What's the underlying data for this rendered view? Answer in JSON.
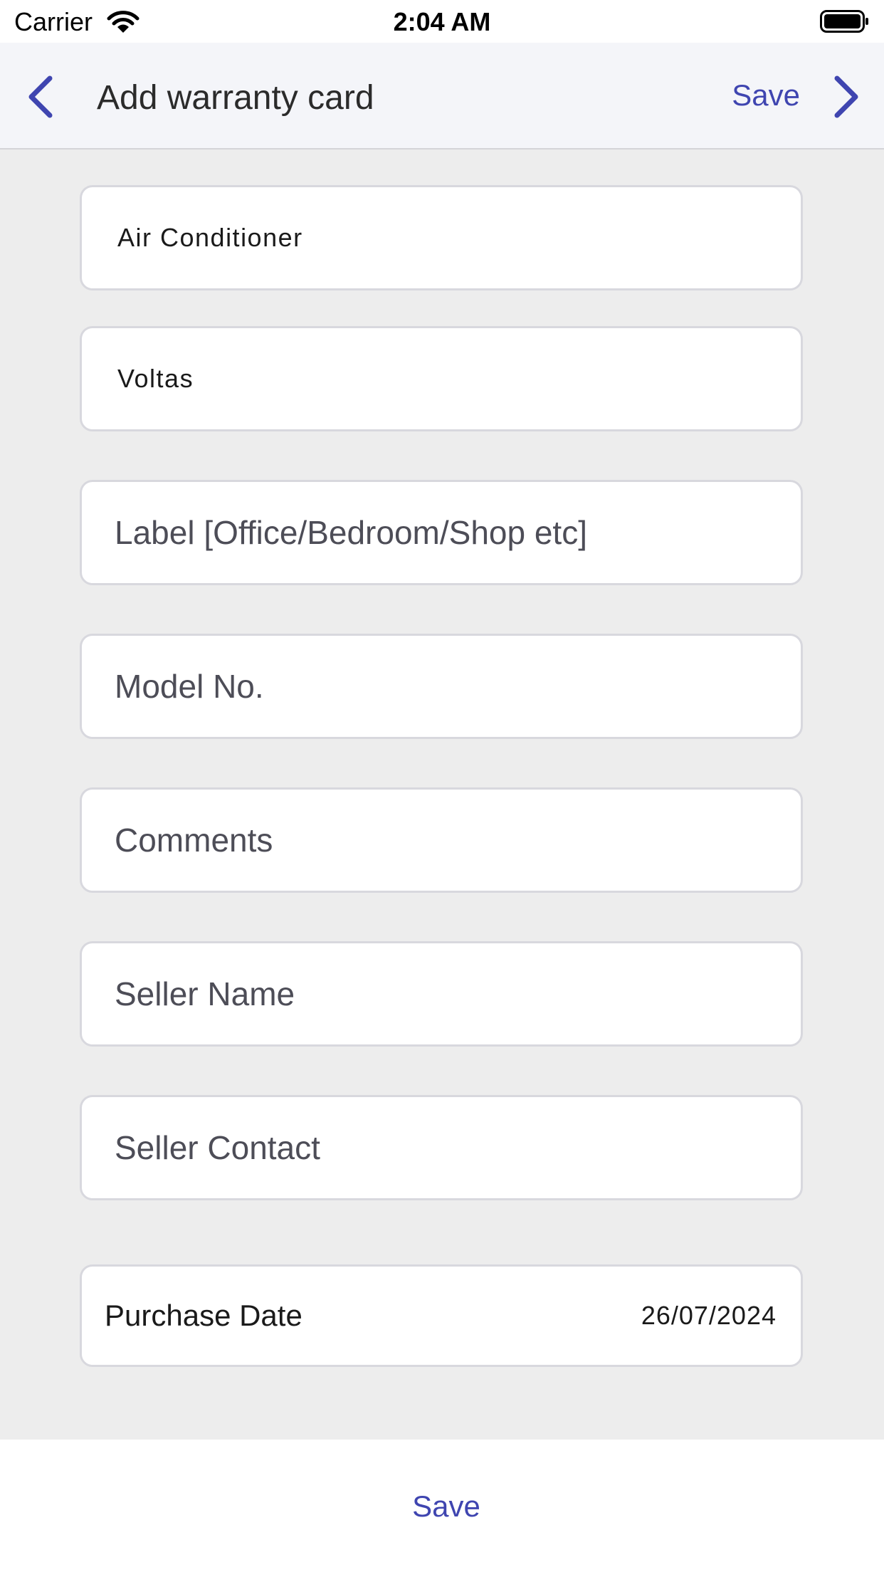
{
  "status_bar": {
    "carrier": "Carrier",
    "time": "2:04 AM"
  },
  "nav": {
    "title": "Add warranty card",
    "save_label": "Save"
  },
  "form": {
    "category_value": "Air Conditioner",
    "brand_value": "Voltas",
    "label_placeholder": "Label [Office/Bedroom/Shop etc]",
    "model_placeholder": "Model No.",
    "comments_placeholder": "Comments",
    "seller_name_placeholder": "Seller Name",
    "seller_contact_placeholder": "Seller Contact",
    "purchase_date_label": "Purchase Date",
    "purchase_date_value": "26/07/2024"
  },
  "footer": {
    "save_label": "Save"
  },
  "colors": {
    "accent": "#3f45b0",
    "background": "#ededed",
    "nav_background": "#f4f5f9"
  }
}
